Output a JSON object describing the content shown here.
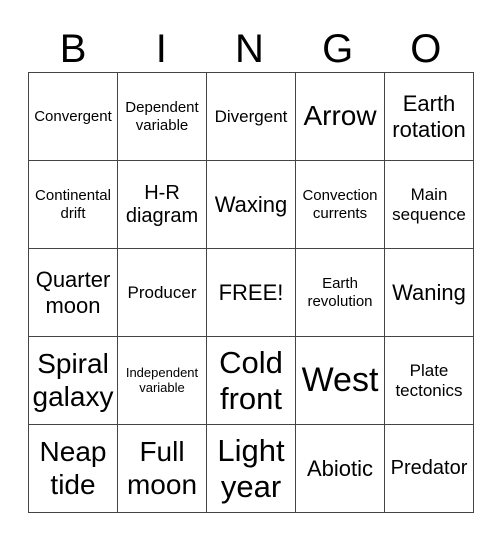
{
  "header": {
    "letters": [
      "B",
      "I",
      "N",
      "G",
      "O"
    ]
  },
  "board": {
    "rows": [
      [
        "Convergent",
        "Dependent variable",
        "Divergent",
        "Arrow",
        "Earth rotation"
      ],
      [
        "Continental drift",
        "H-R diagram",
        "Waxing",
        "Convection currents",
        "Main sequence"
      ],
      [
        "Quarter moon",
        "Producer",
        "FREE!",
        "Earth revolution",
        "Waning"
      ],
      [
        "Spiral galaxy",
        "Independent variable",
        "Cold front",
        "West",
        "Plate tectonics"
      ],
      [
        "Neap tide",
        "Full moon",
        "Light year",
        "Abiotic",
        "Predator"
      ]
    ]
  }
}
